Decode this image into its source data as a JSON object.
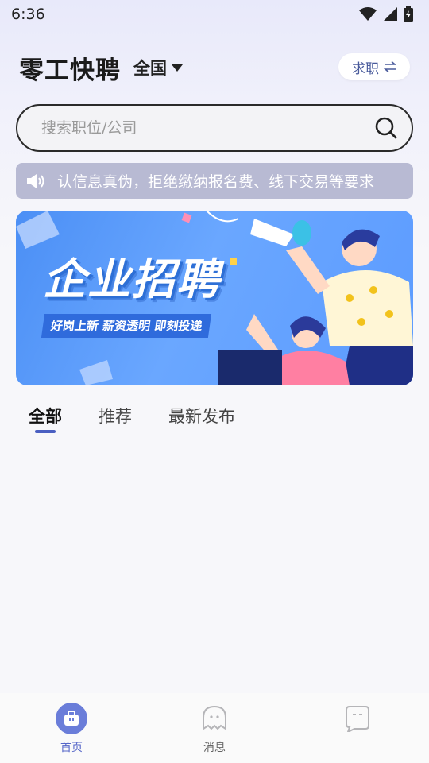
{
  "status": {
    "time": "6:36"
  },
  "header": {
    "app_title": "零工快聘",
    "region": "全国",
    "mode_switch": "求职"
  },
  "search": {
    "placeholder": "搜索职位/公司"
  },
  "notice": {
    "text": "认信息真伪，拒绝缴纳报名费、线下交易等要求"
  },
  "banner": {
    "title": "企业招聘",
    "subtitle": "好岗上新  薪资透明  即刻投递"
  },
  "tabs": [
    {
      "label": "全部",
      "active": true
    },
    {
      "label": "推荐",
      "active": false
    },
    {
      "label": "最新发布",
      "active": false
    }
  ],
  "bottom_nav": [
    {
      "label": "首页",
      "icon": "briefcase-icon",
      "active": true
    },
    {
      "label": "消息",
      "icon": "chat-bubble-icon",
      "active": false
    },
    {
      "label": "",
      "icon": "profile-bubble-icon",
      "active": false
    }
  ],
  "colors": {
    "accent": "#4a5fc1",
    "banner_blue": "#5c9bff",
    "notice_bg": "#b8bad3"
  }
}
